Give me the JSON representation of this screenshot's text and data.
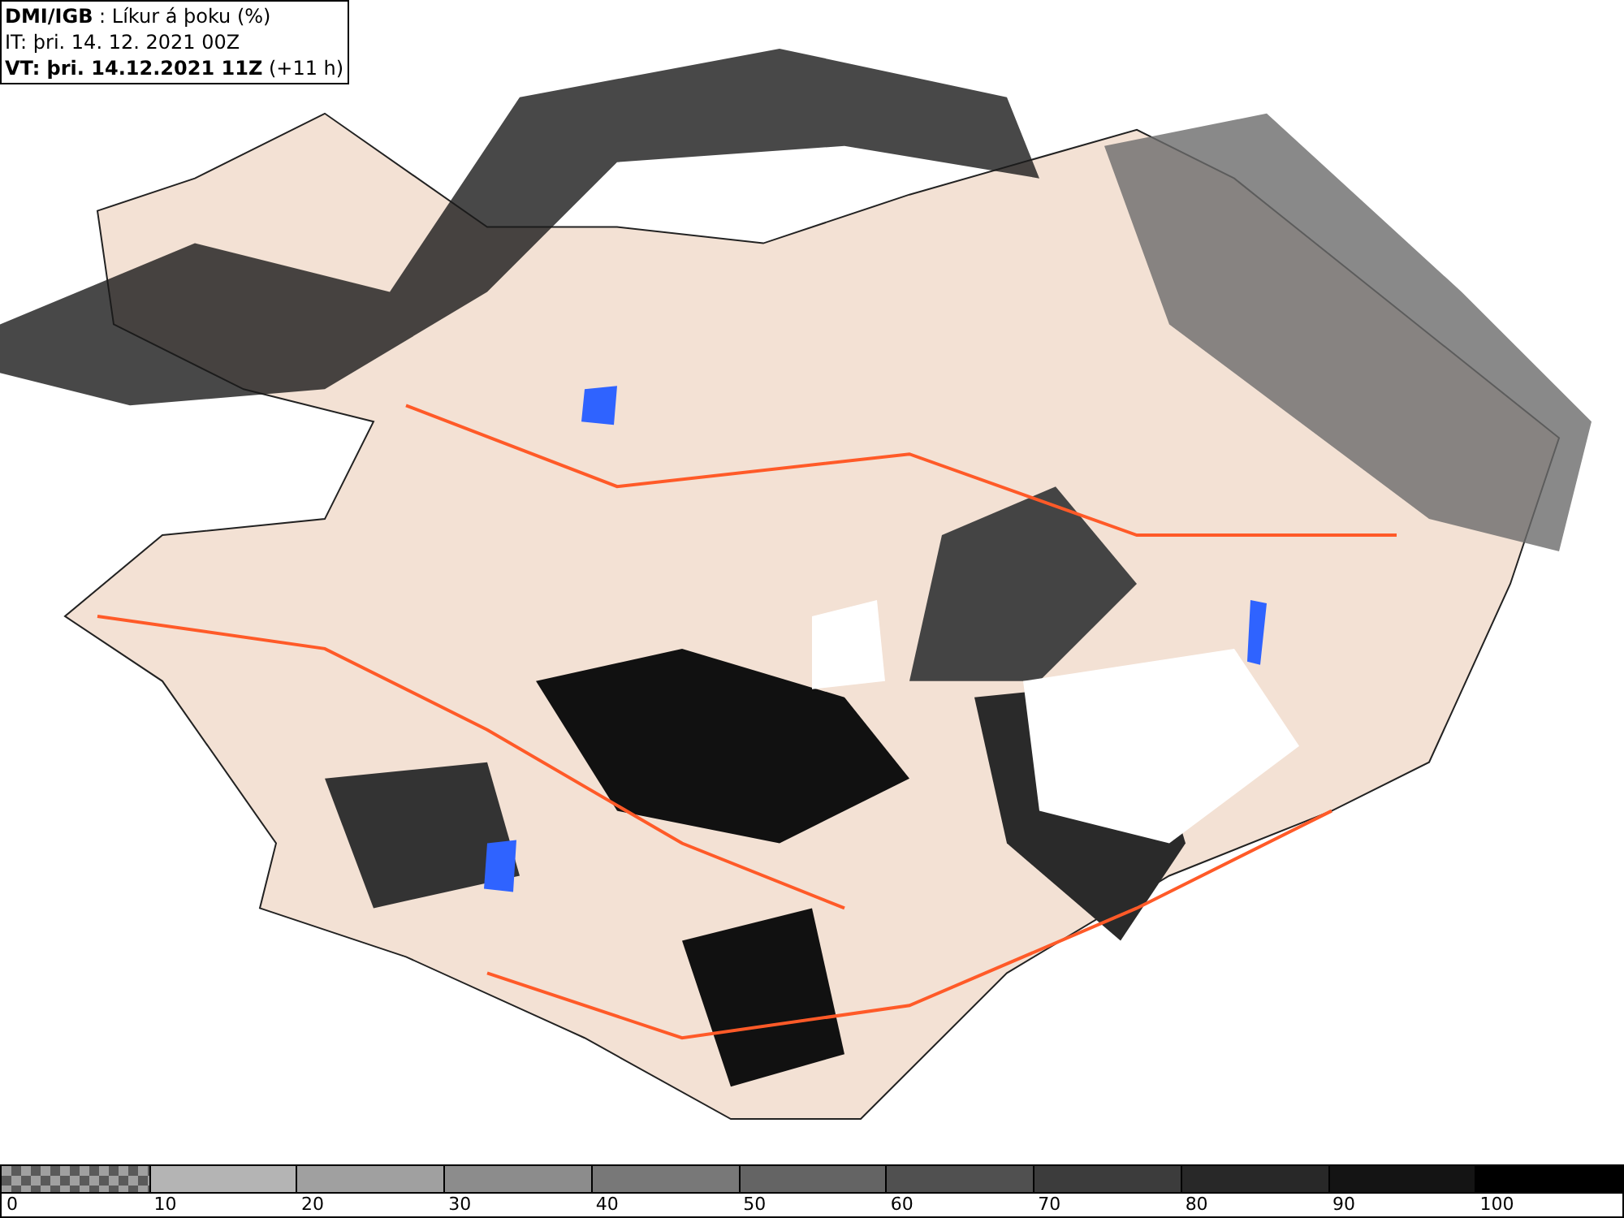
{
  "header": {
    "lines": [
      "**DMI/IGB** : Líkur á þoku (%)",
      "IT: þri. 14. 12. 2021 00Z",
      "**VT: þri. 14.12.2021 11Z** (+11 h)"
    ]
  },
  "legend": {
    "bins": [
      {
        "kind": "checker",
        "label": "0"
      },
      {
        "kind": "solid",
        "color": "#b4b4b4",
        "label": "10"
      },
      {
        "kind": "solid",
        "color": "#a0a0a0",
        "label": "20"
      },
      {
        "kind": "solid",
        "color": "#8c8c8c",
        "label": "30"
      },
      {
        "kind": "solid",
        "color": "#787878",
        "label": "40"
      },
      {
        "kind": "solid",
        "color": "#646464",
        "label": "50"
      },
      {
        "kind": "solid",
        "color": "#505050",
        "label": "60"
      },
      {
        "kind": "solid",
        "color": "#3c3c3c",
        "label": "70"
      },
      {
        "kind": "solid",
        "color": "#282828",
        "label": "80"
      },
      {
        "kind": "solid",
        "color": "#141414",
        "label": "90"
      },
      {
        "kind": "solid",
        "color": "#000000",
        "label": "100"
      }
    ]
  }
}
